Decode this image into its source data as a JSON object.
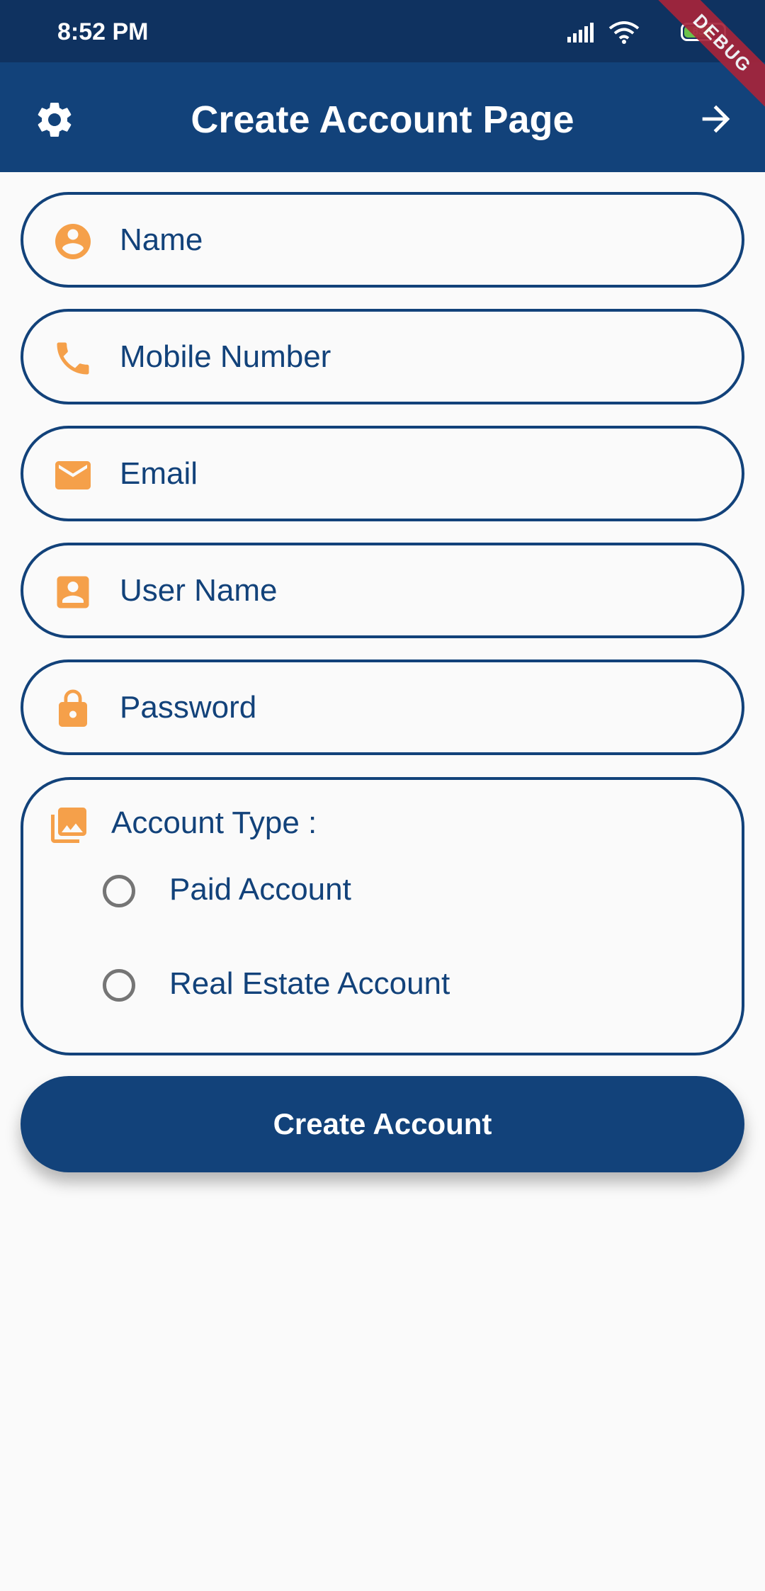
{
  "status_bar": {
    "time": "8:52 PM",
    "battery": "83"
  },
  "debug_banner": "DEBUG",
  "app_bar": {
    "title": "Create Account Page"
  },
  "fields": {
    "name": "Name",
    "mobile": "Mobile Number",
    "email": "Email",
    "username": "User Name",
    "password": "Password"
  },
  "account_type": {
    "label": "Account Type  :",
    "options": [
      "Paid Account",
      "Real Estate Account"
    ]
  },
  "create_button": "Create Account",
  "colors": {
    "primary": "#12427a",
    "status_bar": "#0f3260",
    "accent_icon": "#f5a04a",
    "background": "#fafafa"
  },
  "icons": {
    "settings": "gear-icon",
    "next": "arrow-right-icon",
    "name": "person-circle-icon",
    "mobile": "phone-icon",
    "email": "envelope-icon",
    "username": "contact-card-icon",
    "password": "lock-icon",
    "account_type": "photo-library-icon"
  }
}
